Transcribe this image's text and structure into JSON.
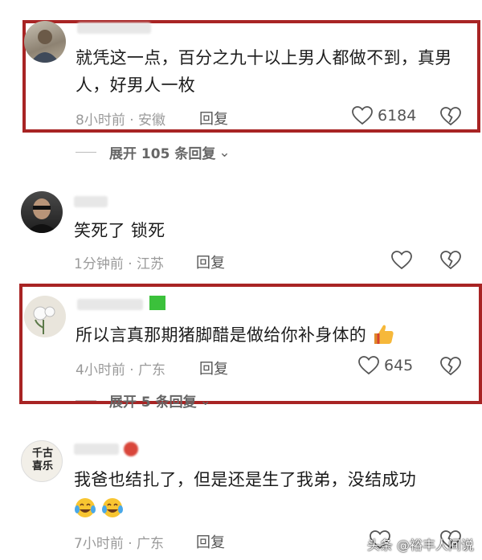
{
  "comments": [
    {
      "text": "就凭这一点，百分之九十以上男人都做不到，真男人，好男人一枚",
      "time_location": "8小时前 · 安徽",
      "reply": "回复",
      "likes": "6184",
      "expand": "展开 105 条回复"
    },
    {
      "text": "笑死了 锁死",
      "time_location": "1分钟前 · 江苏",
      "reply": "回复",
      "likes": ""
    },
    {
      "text": "所以言真那期猪脚醋是做给你补身体的",
      "time_location": "4小时前 · 广东",
      "reply": "回复",
      "likes": "645",
      "expand": "展开 5 条回复"
    },
    {
      "text": "我爸也结扎了，但是还是生了我弟，没结成功",
      "time_location": "7小时前 · 广东",
      "reply": "回复",
      "likes": "",
      "avatar_text": "千古\n喜乐"
    }
  ],
  "watermark": "头条 @裕丰人间说",
  "colors": {
    "highlight": "#a82424",
    "meta": "#9a9a9a"
  },
  "icons": [
    "heart-outline-icon",
    "broken-heart-icon",
    "chevron-down-icon",
    "thumbs-up-emoji",
    "crying-laughing-emoji"
  ]
}
